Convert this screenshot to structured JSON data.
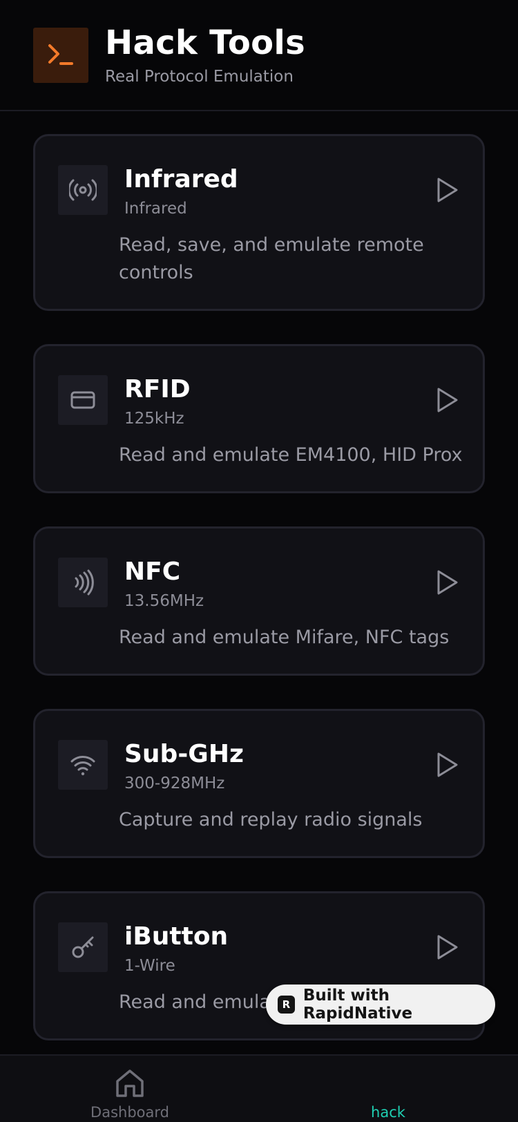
{
  "header": {
    "title": "Hack Tools",
    "subtitle": "Real Protocol Emulation",
    "logo_icon": "terminal-icon",
    "accent": "#f47a2a"
  },
  "tools": [
    {
      "name": "Infrared",
      "freq": "Infrared",
      "desc": "Read, save, and emulate remote controls",
      "icon": "infrared-signal-icon"
    },
    {
      "name": "RFID",
      "freq": "125kHz",
      "desc": "Read and emulate EM4100, HID Prox",
      "icon": "card-icon"
    },
    {
      "name": "NFC",
      "freq": "13.56MHz",
      "desc": "Read and emulate Mifare, NFC tags",
      "icon": "nfc-icon"
    },
    {
      "name": "Sub-GHz",
      "freq": "300-928MHz",
      "desc": "Capture and replay radio signals",
      "icon": "wifi-icon"
    },
    {
      "name": "iButton",
      "freq": "1-Wire",
      "desc": "Read and emulate",
      "icon": "key-icon"
    }
  ],
  "badge": {
    "text": "Built with RapidNative",
    "logo": "R"
  },
  "nav": [
    {
      "label": "Dashboard",
      "icon": "home-icon",
      "active": false
    },
    {
      "label": "hack",
      "icon": "",
      "active": true,
      "color": "#1fcfb2"
    }
  ]
}
